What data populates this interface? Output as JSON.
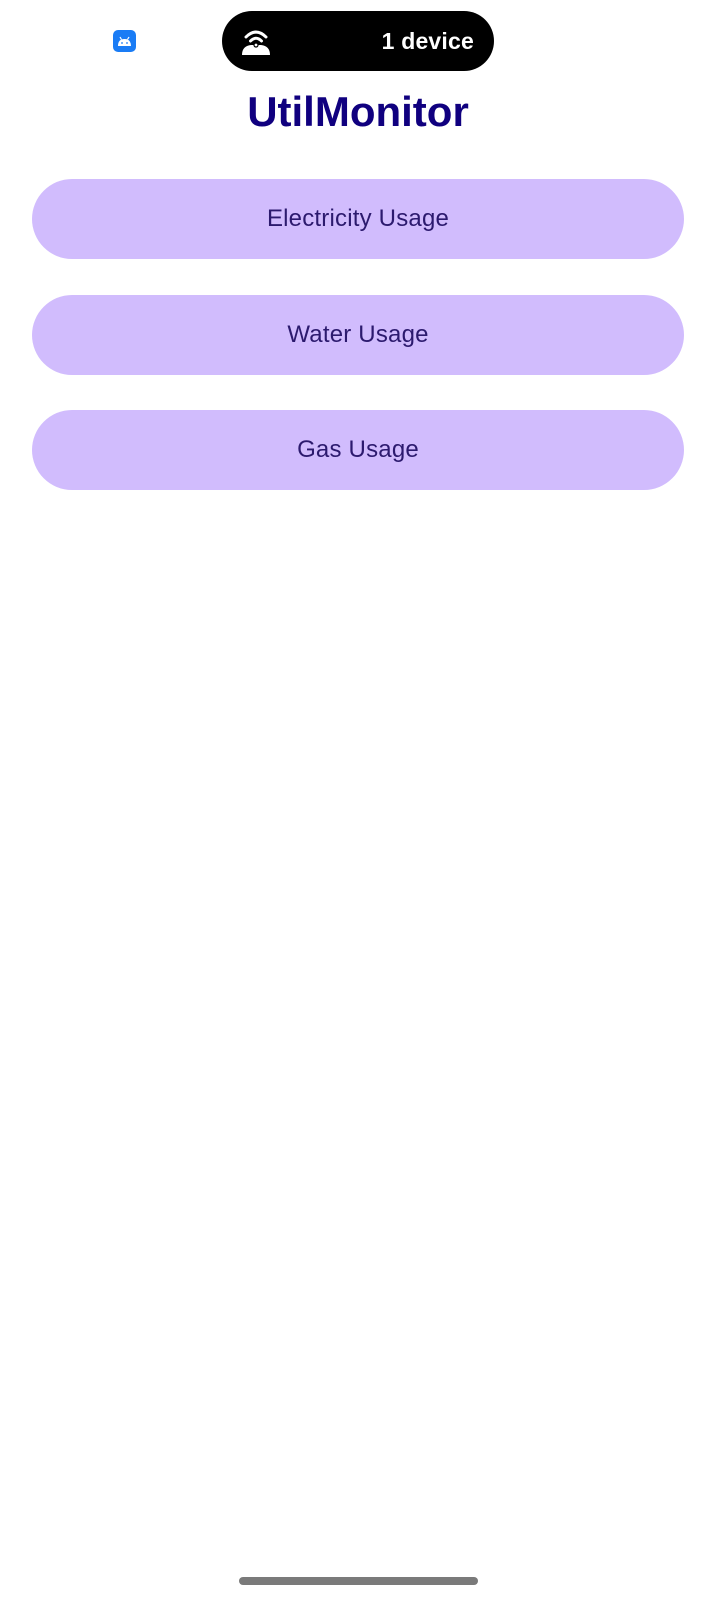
{
  "status_bar": {
    "notification_icon": "android-app-icon",
    "pill_icon": "wireless-cast-icon",
    "pill_text": "1 device"
  },
  "app": {
    "title": "UtilMonitor"
  },
  "buttons": [
    {
      "label": "Electricity Usage"
    },
    {
      "label": "Water Usage"
    },
    {
      "label": "Gas Usage"
    }
  ],
  "colors": {
    "title": "#10007f",
    "button_background": "#d1bcfd",
    "button_text": "#2c1a6e",
    "pill_background": "#000000",
    "notification_icon": "#1a7cf5"
  }
}
